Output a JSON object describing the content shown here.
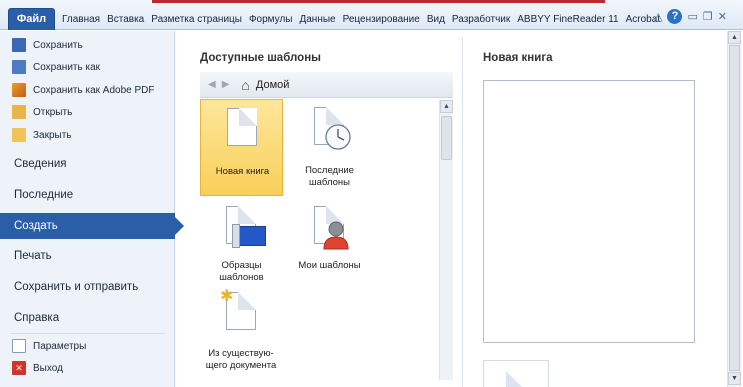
{
  "ribbon": {
    "file_tab": "Файл",
    "tabs": [
      "Главная",
      "Вставка",
      "Разметка страницы",
      "Формулы",
      "Данные",
      "Рецензирование",
      "Вид",
      "Разработчик",
      "ABBYY FineReader 11",
      "Acrobat"
    ]
  },
  "nav": {
    "save": "Сохранить",
    "save_as": "Сохранить как",
    "save_pdf": "Сохранить как Adobe PDF",
    "open": "Открыть",
    "close": "Закрыть",
    "info": "Сведения",
    "recent": "Последние",
    "new": "Создать",
    "print": "Печать",
    "save_send": "Сохранить и отправить",
    "help": "Справка",
    "options": "Параметры",
    "exit": "Выход"
  },
  "templates": {
    "title": "Доступные шаблоны",
    "home": "Домой",
    "items": [
      {
        "label": "Новая книга"
      },
      {
        "label": "Последние шаблоны"
      },
      {
        "label": "Образцы шаблонов"
      },
      {
        "label": "Мои шаблоны"
      },
      {
        "label": "Из существую-щего документа"
      }
    ]
  },
  "preview": {
    "title": "Новая книга"
  },
  "colors": {
    "accent": "#2a5ea8",
    "selected_tile": "#f9cf5a"
  }
}
